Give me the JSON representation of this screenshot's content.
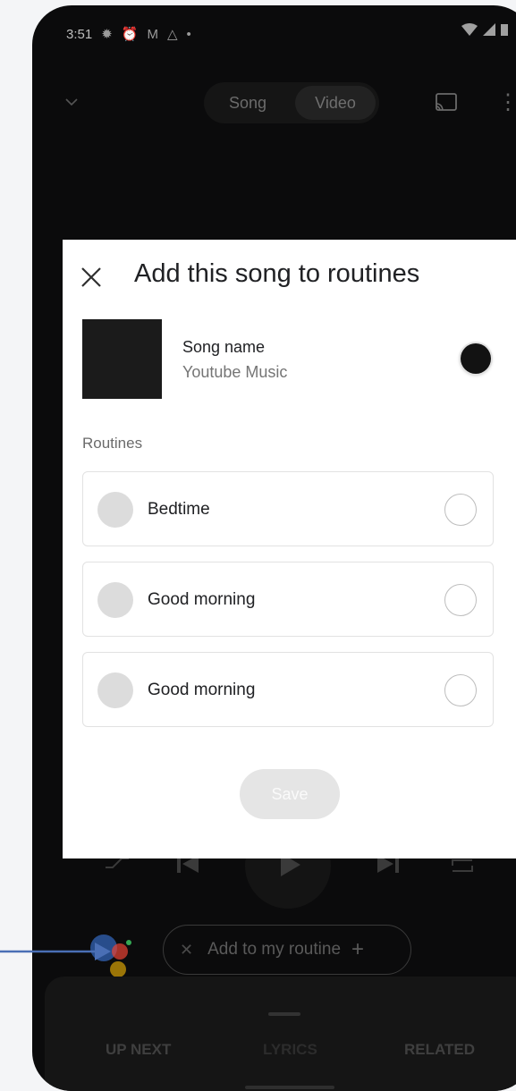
{
  "status_bar": {
    "time": "3:51"
  },
  "player": {
    "toggle": {
      "song_label": "Song",
      "video_label": "Video"
    },
    "routine_chip": {
      "label": "Add to my routine"
    },
    "tabs": [
      "UP NEXT",
      "LYRICS",
      "RELATED"
    ]
  },
  "dialog": {
    "title": "Add this song to routines",
    "song": {
      "name": "Song name",
      "artist": "Youtube Music",
      "selected": true
    },
    "section_label": "Routines",
    "routines": [
      {
        "label": "Bedtime",
        "selected": false
      },
      {
        "label": "Good morning",
        "selected": false
      },
      {
        "label": "Good morning",
        "selected": false
      }
    ],
    "save_label": "Save"
  },
  "colors": {
    "arrow": "#4a6fb5",
    "assistant_blue": "#4285f4",
    "assistant_red": "#ea4335",
    "assistant_yellow": "#fbbc05",
    "assistant_green": "#34a853"
  }
}
